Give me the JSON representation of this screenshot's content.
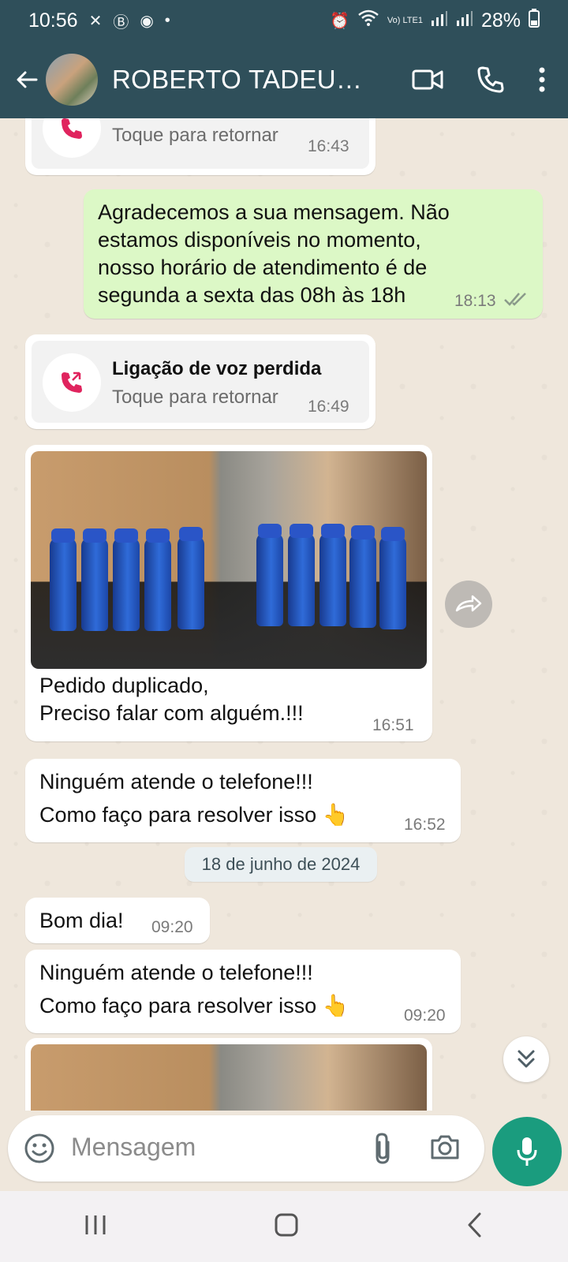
{
  "status_bar": {
    "time": "10:56",
    "battery": "28%",
    "network_label": "Vo) LTE1"
  },
  "header": {
    "contact_name": "ROBERTO TADEU LI...",
    "icons": [
      "back-arrow-icon",
      "video-call-icon",
      "phone-icon",
      "more-vert-icon"
    ]
  },
  "messages": [
    {
      "type": "missed_call_partial",
      "subtitle": "Toque para retornar",
      "time": "16:43"
    },
    {
      "type": "outgoing_text",
      "lines": [
        "Agradecemos a sua mensagem. Não",
        "estamos disponíveis no momento,",
        "nosso horário de atendimento é de",
        "segunda a sexta  das 08h às 18h"
      ],
      "time": "18:13",
      "status": "delivered"
    },
    {
      "type": "missed_call",
      "title": "Ligação de voz perdida",
      "subtitle": "Toque para retornar",
      "time": "16:49"
    },
    {
      "type": "image_with_caption",
      "caption_lines": [
        "Pedido duplicado,",
        "Preciso falar com alguém.!!!"
      ],
      "time": "16:51"
    },
    {
      "type": "incoming_text",
      "lines": [
        "Ninguém atende o telefone!!!",
        "Como faço para resolver isso 👆"
      ],
      "time": "16:52"
    },
    {
      "type": "incoming_text",
      "lines": [
        "Bom dia!"
      ],
      "time": "09:20"
    },
    {
      "type": "incoming_text",
      "lines": [
        "Ninguém atende o telefone!!!",
        "Como faço para resolver isso 👆"
      ],
      "time": "09:20"
    }
  ],
  "date_divider": "18 de junho de 2024",
  "composer": {
    "placeholder": "Mensagem"
  },
  "colors": {
    "header_bg": "#2f4f5a",
    "outgoing_bubble": "#dcf8c6",
    "incoming_bubble": "#ffffff",
    "mic_button": "#1a9c7e",
    "missed_call_red": "#e0245e"
  }
}
